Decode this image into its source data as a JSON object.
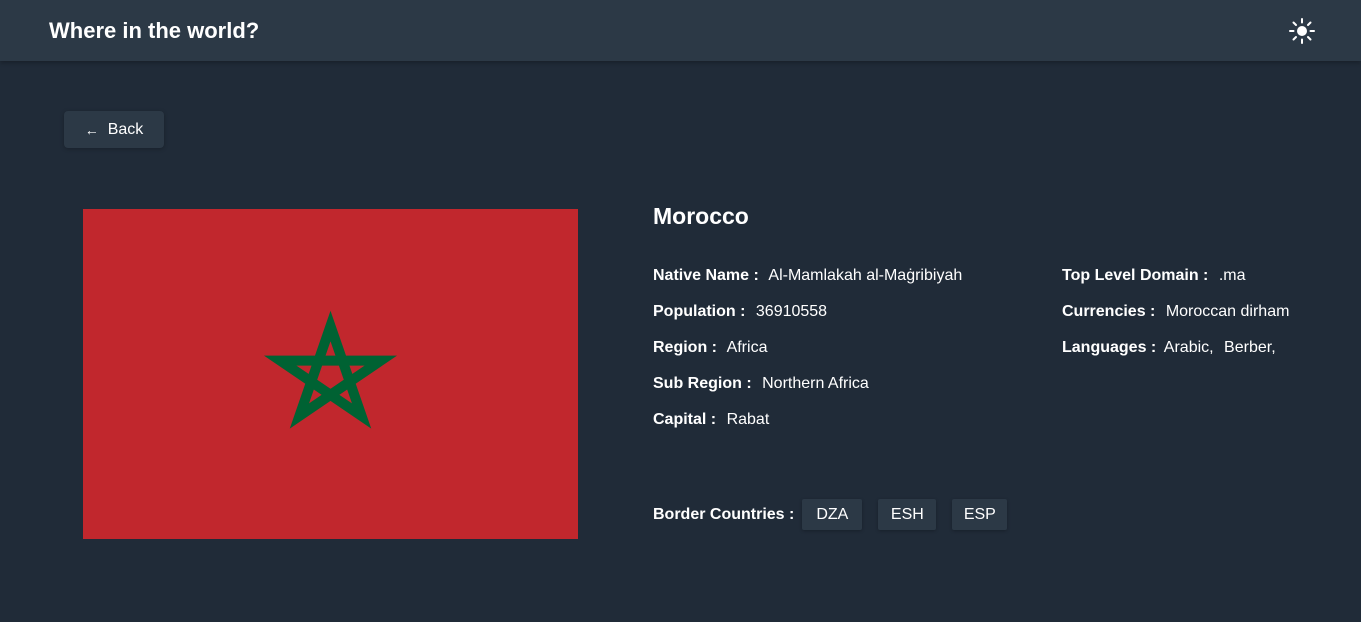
{
  "header": {
    "title": "Where in the world?",
    "theme_icon": "sun-icon"
  },
  "back_button": {
    "label": "Back",
    "icon": "arrow-left-icon"
  },
  "country": {
    "name": "Morocco",
    "flag": {
      "background": "#c1272d",
      "star": "#006233"
    },
    "native_name": {
      "label": "Native Name :",
      "value": "Al-Mamlakah al-Maġribiyah"
    },
    "population": {
      "label": "Population :",
      "value": "36910558"
    },
    "region": {
      "label": "Region :",
      "value": "Africa"
    },
    "sub_region": {
      "label": "Sub Region :",
      "value": "Northern Africa"
    },
    "capital": {
      "label": "Capital :",
      "value": "Rabat"
    },
    "top_level_domain": {
      "label": "Top Level Domain :",
      "value": ".ma"
    },
    "currencies": {
      "label": "Currencies :",
      "value": "Moroccan dirham"
    },
    "languages": {
      "label": "Languages :",
      "values": [
        "Arabic,",
        "Berber,"
      ]
    },
    "border_countries": {
      "label": "Border Countries :",
      "items": [
        "DZA",
        "ESH",
        "ESP"
      ]
    }
  },
  "colors": {
    "background": "#202b38",
    "surface": "#2c3946",
    "text": "#ffffff"
  }
}
